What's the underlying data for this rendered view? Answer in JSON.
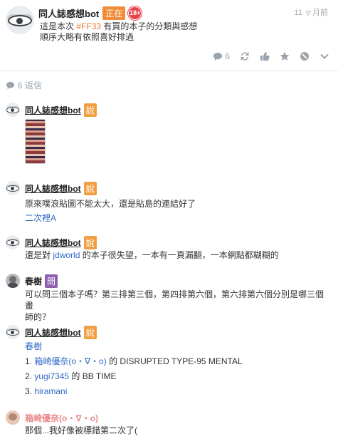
{
  "post": {
    "author": "同人誌感想bot",
    "live_badge": "正在",
    "age_badge": "18+",
    "time": "11 ヶ月前",
    "text_prefix": "這是本次",
    "tag": "#FF33",
    "text_suffix": "有買的本子的分類與感想",
    "text_line2": "順序大略有依照喜好排過",
    "actions": {
      "comment_count": "6",
      "icons": [
        "comment-icon",
        "replurk-icon",
        "like-icon",
        "favorite-icon",
        "mute-icon",
        "more-icon"
      ]
    }
  },
  "replies_header": {
    "count_label": "6 返信"
  },
  "comments": [
    {
      "author": "同人誌感想bot",
      "verb": "說"
    },
    {
      "author": "同人誌感想bot",
      "verb": "說",
      "line1": "原來噗浪貼圖不能太大，還是貼島的連結好了",
      "line2": "二次裡A"
    },
    {
      "author": "同人誌感想bot",
      "verb": "說",
      "prefix": "還是對",
      "link": "jdworld",
      "suffix": "的本子很失望，一本有一頁漏翻，一本網點都糊糊的"
    },
    {
      "author": "春樹",
      "verb": "問",
      "line1": "可以問三個本子嗎？第三排第三個，第四排第六個，第六排第六個分別是哪三個畫",
      "line2": "師的？"
    },
    {
      "author": "同人誌感想bot",
      "verb": "說",
      "mention": "春樹",
      "items": [
        {
          "num": "1.",
          "link": "箱崎優奈(o・∇・o)",
          "rest": "的 DISRUPTED TYPE-95 MENTAL"
        },
        {
          "num": "2.",
          "link": "yugi7345",
          "rest": "的 BB TIME"
        },
        {
          "num": "3.",
          "link": "hiramani",
          "rest": ""
        }
      ]
    },
    {
      "author": "箱崎優奈(o・∇・o)",
      "line1": "那個...我好像被標錯第二次了("
    }
  ],
  "colors": {
    "accent_orange": "#f08c3a",
    "link_blue": "#3068c4",
    "ask_purple": "#8e5fae",
    "age_red": "#e8434b"
  }
}
